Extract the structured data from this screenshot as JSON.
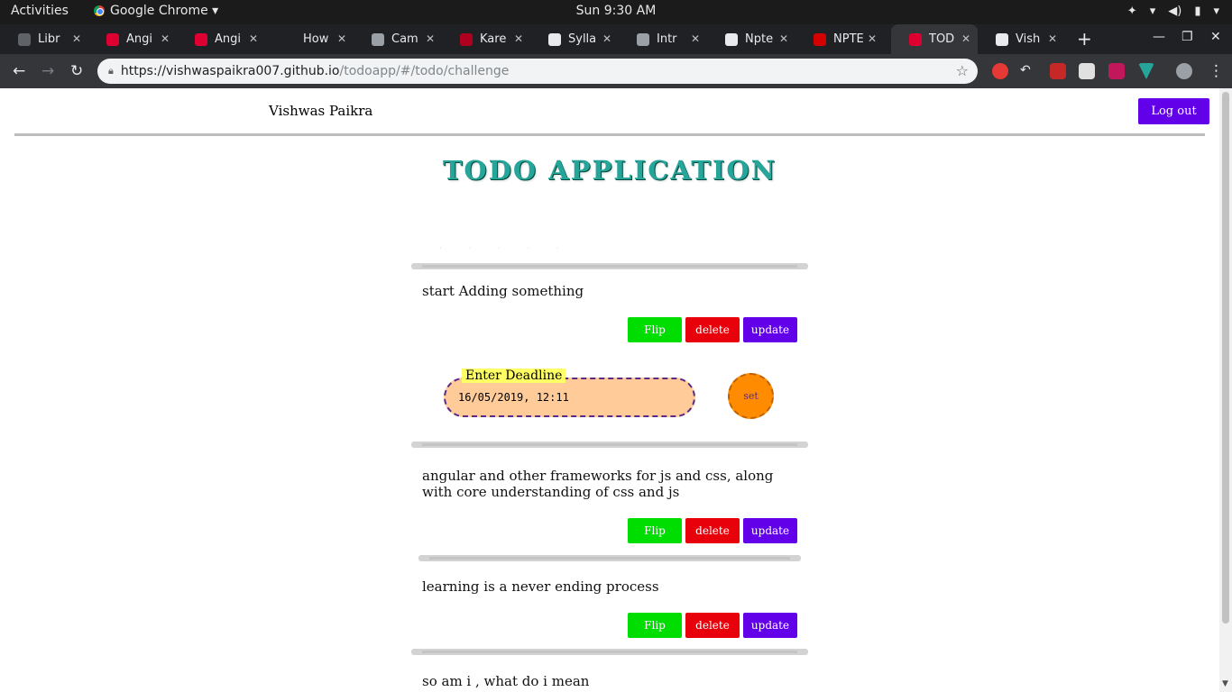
{
  "system_bar": {
    "activities": "Activities",
    "app_name": "Google Chrome ▾",
    "clock": "Sun  9:30 AM"
  },
  "tabs": [
    {
      "label": "Libr",
      "fav_color": "#5f6368"
    },
    {
      "label": "Angi",
      "fav_color": "#dd0031"
    },
    {
      "label": "Angi",
      "fav_color": "#dd0031"
    },
    {
      "label": "How",
      "fav_color": "#202124"
    },
    {
      "label": "Cam",
      "fav_color": "#9aa0a6"
    },
    {
      "label": "Kare",
      "fav_color": "#b00020"
    },
    {
      "label": "Sylla",
      "fav_color": "#e8eaed"
    },
    {
      "label": "Intr",
      "fav_color": "#9aa0a6"
    },
    {
      "label": "Npte",
      "fav_color": "#e8eaed"
    },
    {
      "label": "NPTE",
      "fav_color": "#d50000"
    },
    {
      "label": "TOD",
      "fav_color": "#dd0031"
    },
    {
      "label": "Vish",
      "fav_color": "#e8eaed"
    }
  ],
  "address_bar": {
    "url": "https://vishwaspaikra007.github.io",
    "path": "/todoapp/#/todo/challenge"
  },
  "page": {
    "user_name": "Vishwas Paikra",
    "logout_label": "Log out",
    "title": "TODO APPLICATION",
    "faint_text": ". . . . .",
    "todos": [
      {
        "text": "start Adding something",
        "flip": "Flip",
        "delete": "delete",
        "update": "update"
      },
      {
        "text": "angular and other frameworks for js and css, along with core understanding of css and js",
        "flip": "Flip",
        "delete": "delete",
        "update": "update"
      },
      {
        "text": "learning is a never ending process",
        "flip": "Flip",
        "delete": "delete",
        "update": "update"
      },
      {
        "text": "so am i , what do i mean"
      }
    ],
    "deadline": {
      "legend": "Enter Deadline",
      "value": "16/05/2019, 12:11",
      "set_label": "set"
    }
  },
  "colors": {
    "accent_purple": "#6200ea",
    "flip_green": "#00dd00",
    "delete_red": "#e8000b",
    "title_teal": "#26a69a",
    "set_orange": "#ff8c00",
    "deadline_bg": "#ffcc99"
  }
}
